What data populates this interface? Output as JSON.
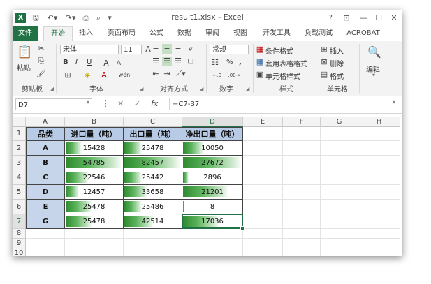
{
  "titlebar": {
    "app_icon": "X",
    "title": "result1.xlsx - Excel",
    "help": "?",
    "ribbon_display": "⊡",
    "minimize": "—",
    "maximize": "☐",
    "close": "✕"
  },
  "tabs": [
    "文件",
    "开始",
    "插入",
    "页面布局",
    "公式",
    "数据",
    "审阅",
    "视图",
    "开发工具",
    "负载测试",
    "ACROBAT"
  ],
  "ribbon": {
    "clipboard": {
      "paste": "粘贴",
      "label": "剪贴板"
    },
    "font": {
      "name": "宋体",
      "size": "11",
      "bold": "B",
      "italic": "I",
      "underline": "U",
      "label": "字体"
    },
    "alignment": {
      "label": "对齐方式"
    },
    "number": {
      "format": "常规",
      "percent": "%",
      "comma": ",",
      "label": "数字"
    },
    "styles": {
      "conditional": "条件格式",
      "table": "套用表格格式",
      "cell_styles": "单元格样式",
      "label": "样式"
    },
    "cells": {
      "insert": "插入",
      "delete": "删除",
      "format": "格式",
      "label": "单元格"
    },
    "editing": {
      "label": "编辑"
    }
  },
  "formula_bar": {
    "name_box": "D7",
    "cancel": "✕",
    "enter": "✓",
    "fx": "fx",
    "formula": "=C7-B7"
  },
  "columns": [
    "A",
    "B",
    "C",
    "D",
    "E",
    "F",
    "G",
    "H"
  ],
  "rows": [
    "1",
    "2",
    "3",
    "4",
    "5",
    "6",
    "7",
    "8",
    "9",
    "10"
  ],
  "table": {
    "headers": [
      "品类",
      "进口量（吨）",
      "出口量（吨）",
      "净出口量（吨）"
    ],
    "rows": [
      {
        "cat": "A",
        "import": "15428",
        "export": "25478",
        "net": "10050",
        "import_fill": 0.28,
        "export_fill": 0.31,
        "net_fill": 0.36
      },
      {
        "cat": "B",
        "import": "54785",
        "export": "82457",
        "net": "27672",
        "import_fill": 1.0,
        "export_fill": 1.0,
        "net_fill": 1.0
      },
      {
        "cat": "C",
        "import": "22546",
        "export": "25442",
        "net": "2896",
        "import_fill": 0.41,
        "export_fill": 0.31,
        "net_fill": 0.1
      },
      {
        "cat": "D",
        "import": "12457",
        "export": "33658",
        "net": "21201",
        "import_fill": 0.23,
        "export_fill": 0.41,
        "net_fill": 0.77
      },
      {
        "cat": "E",
        "import": "25478",
        "export": "25486",
        "net": "8",
        "import_fill": 0.47,
        "export_fill": 0.31,
        "net_fill": 0.02
      },
      {
        "cat": "G",
        "import": "25478",
        "export": "42514",
        "net": "17036",
        "import_fill": 0.47,
        "export_fill": 0.52,
        "net_fill": 0.62
      }
    ]
  }
}
